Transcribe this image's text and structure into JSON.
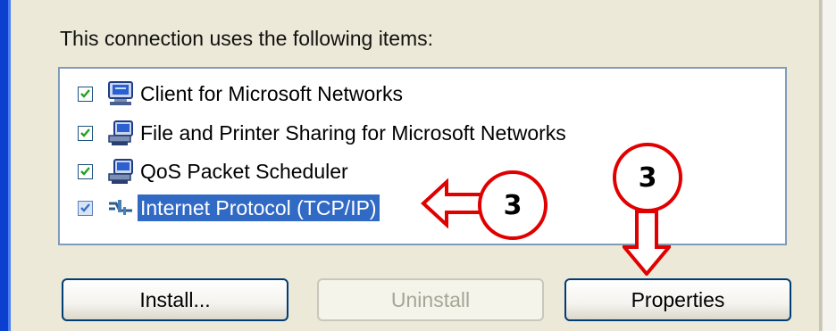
{
  "dialog": {
    "caption": "This connection uses the following items:",
    "items": [
      {
        "label": "Client for Microsoft Networks",
        "checked": true,
        "icon": "network-client-icon",
        "selected": false
      },
      {
        "label": "File and Printer Sharing for Microsoft Networks",
        "checked": true,
        "icon": "network-service-icon",
        "selected": false
      },
      {
        "label": "QoS Packet Scheduler",
        "checked": true,
        "icon": "network-service-icon",
        "selected": false
      },
      {
        "label": "Internet Protocol (TCP/IP)",
        "checked": true,
        "icon": "network-protocol-icon",
        "selected": true
      }
    ],
    "buttons": {
      "install": "Install...",
      "uninstall": "Uninstall",
      "properties": "Properties"
    }
  },
  "annotations": {
    "step_left": "3",
    "step_right": "3",
    "color": "#e00000"
  },
  "colors": {
    "selection": "#316ac5",
    "dialog_bg": "#ece9d8",
    "window_border": "#0a3fd0"
  }
}
